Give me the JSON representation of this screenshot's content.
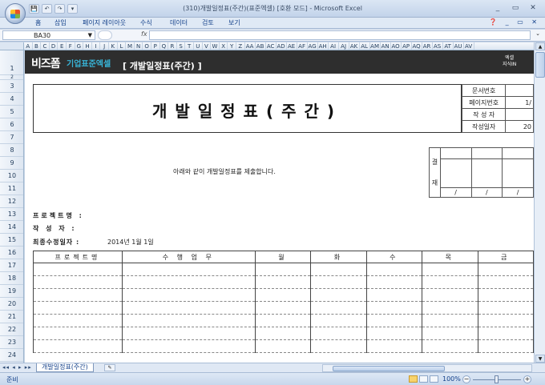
{
  "window": {
    "title": "(310)개발일정표(주간)(표준엑셀) [호환 모드] - Microsoft Excel",
    "controls": [
      "_",
      "▭",
      "✕"
    ]
  },
  "qat": [
    "💾",
    "↶",
    "↷",
    "▾"
  ],
  "menu": {
    "tabs": [
      "홈",
      "삽입",
      "페이지 레이아웃",
      "수식",
      "데이터",
      "검토",
      "보기"
    ],
    "help": "❓ _ ▭ ✕"
  },
  "formula_bar": {
    "name_box": "BA30",
    "name_dropdown": "▼",
    "fx": "fx",
    "value": ""
  },
  "columns": [
    "A",
    "B",
    "C",
    "D",
    "E",
    "F",
    "G",
    "H",
    "I",
    "J",
    "K",
    "L",
    "M",
    "N",
    "O",
    "P",
    "Q",
    "R",
    "S",
    "T",
    "U",
    "V",
    "W",
    "X",
    "Y",
    "Z",
    "AA",
    "AB",
    "AC",
    "AD",
    "AE",
    "AF",
    "AG",
    "AH",
    "AI",
    "AJ",
    "AK",
    "AL",
    "AM",
    "AN",
    "AO",
    "AP",
    "AQ",
    "AR",
    "AS",
    "AT",
    "AU",
    "AV"
  ],
  "rows": [
    "1",
    "2",
    "3",
    "4",
    "5",
    "6",
    "7",
    "8",
    "9",
    "10",
    "11",
    "12",
    "13",
    "14",
    "15",
    "16",
    "17",
    "18",
    "19",
    "20",
    "21",
    "22",
    "23",
    "24"
  ],
  "brand": {
    "logo": "비즈폼",
    "sub": "기업표준엑셀",
    "title": "[ 개발일정표(주간) ]",
    "right_line1": "엑셀",
    "right_line2": "지식IN"
  },
  "doc": {
    "title": "개발일정표(주간)",
    "info_labels": [
      "문서번호",
      "페이지번호",
      "작 성 자",
      "작성일자"
    ],
    "info_values": [
      "",
      "1/",
      "",
      "20"
    ],
    "approval_label_top": "결",
    "approval_label_bottom": "재",
    "approval_slash": "/",
    "statement": "아래와 같이 개발일정표를 제출합니다.",
    "fields": {
      "project": "프로젝트명 :",
      "author": "작    성    자 :",
      "last_modified": "최종수정일자 :"
    },
    "last_modified_value": "2014년 1월 1일"
  },
  "schedule": {
    "headers": [
      "프로젝트명",
      "수 행 업 무",
      "월",
      "화",
      "수",
      "목",
      "금"
    ],
    "row_count": 7
  },
  "sheet_tabs": {
    "nav": "◂◂ ◂ ▸ ▸▸",
    "active": "개발일정표(주간)"
  },
  "status": {
    "ready": "준비",
    "zoom": "100%",
    "minus": "−",
    "plus": "+"
  }
}
